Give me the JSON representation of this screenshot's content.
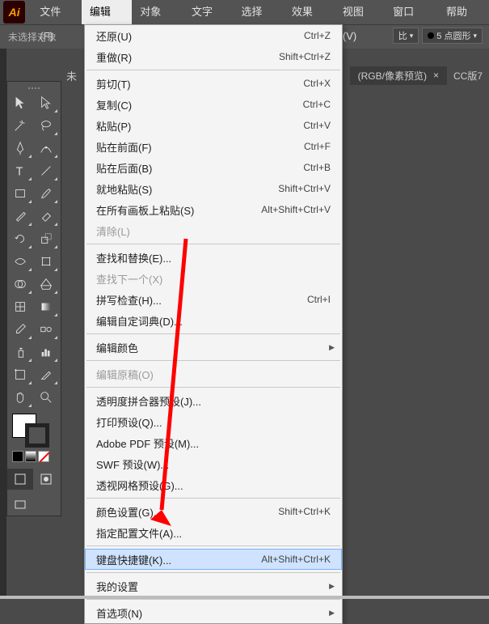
{
  "app_logo": "Ai",
  "menus": [
    "文件(F)",
    "编辑(E)",
    "对象(O)",
    "文字(T)",
    "选择(S)",
    "效果(C)",
    "视图(V)",
    "窗口(W)",
    "帮助(H)"
  ],
  "active_menu_index": 1,
  "no_selection_label": "未选择对象",
  "stroke_dropdown_cut": "比",
  "stroke_value": "5 点圆形",
  "tab_cut_label": "未",
  "doc_tab_label": "(RGB/像素预览)",
  "doc_tab_close": "×",
  "doc_tab2_label": "CC版7",
  "dropdown": [
    {
      "type": "item",
      "label": "还原(U)",
      "shortcut": "Ctrl+Z"
    },
    {
      "type": "item",
      "label": "重做(R)",
      "shortcut": "Shift+Ctrl+Z"
    },
    {
      "type": "sep"
    },
    {
      "type": "item",
      "label": "剪切(T)",
      "shortcut": "Ctrl+X"
    },
    {
      "type": "item",
      "label": "复制(C)",
      "shortcut": "Ctrl+C"
    },
    {
      "type": "item",
      "label": "粘贴(P)",
      "shortcut": "Ctrl+V"
    },
    {
      "type": "item",
      "label": "贴在前面(F)",
      "shortcut": "Ctrl+F"
    },
    {
      "type": "item",
      "label": "贴在后面(B)",
      "shortcut": "Ctrl+B"
    },
    {
      "type": "item",
      "label": "就地粘贴(S)",
      "shortcut": "Shift+Ctrl+V"
    },
    {
      "type": "item",
      "label": "在所有画板上粘贴(S)",
      "shortcut": "Alt+Shift+Ctrl+V"
    },
    {
      "type": "item",
      "label": "清除(L)",
      "disabled": true
    },
    {
      "type": "sep"
    },
    {
      "type": "item",
      "label": "查找和替换(E)..."
    },
    {
      "type": "item",
      "label": "查找下一个(X)",
      "disabled": true
    },
    {
      "type": "item",
      "label": "拼写检查(H)...",
      "shortcut": "Ctrl+I"
    },
    {
      "type": "item",
      "label": "编辑自定词典(D)..."
    },
    {
      "type": "sep"
    },
    {
      "type": "item",
      "label": "编辑颜色",
      "submenu": true
    },
    {
      "type": "sep"
    },
    {
      "type": "item",
      "label": "编辑原稿(O)",
      "disabled": true
    },
    {
      "type": "sep"
    },
    {
      "type": "item",
      "label": "透明度拼合器预设(J)..."
    },
    {
      "type": "item",
      "label": "打印预设(Q)..."
    },
    {
      "type": "item",
      "label": "Adobe PDF 预设(M)..."
    },
    {
      "type": "item",
      "label": "SWF 预设(W)..."
    },
    {
      "type": "item",
      "label": "透视网格预设(G)..."
    },
    {
      "type": "sep"
    },
    {
      "type": "item",
      "label": "颜色设置(G)...",
      "shortcut": "Shift+Ctrl+K"
    },
    {
      "type": "item",
      "label": "指定配置文件(A)..."
    },
    {
      "type": "sep"
    },
    {
      "type": "item",
      "label": "键盘快捷键(K)...",
      "shortcut": "Alt+Shift+Ctrl+K",
      "highlight": true
    },
    {
      "type": "sep"
    },
    {
      "type": "item",
      "label": "我的设置",
      "submenu": true
    },
    {
      "type": "sep"
    },
    {
      "type": "item",
      "label": "首选项(N)",
      "submenu": true
    }
  ],
  "tools_left": [
    "selection",
    "pen",
    "type",
    "rect",
    "brush",
    "rotate",
    "warp",
    "mesh",
    "eyedropper",
    "blend",
    "artboard",
    "slice",
    "hand"
  ],
  "tools_right": [
    "direct-select",
    "curve",
    "line",
    "ellipse",
    "eraser",
    "scale",
    "free",
    "gradient",
    "measure",
    "symbol",
    "graph",
    "zoom",
    "print"
  ]
}
